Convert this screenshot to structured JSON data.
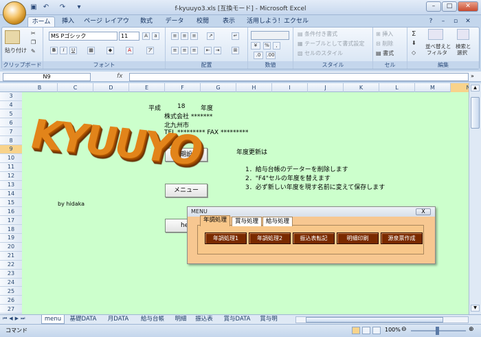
{
  "window": {
    "title": "f-kyuuyo3.xls  [互換モード] - Microsoft Excel"
  },
  "ribbon_tabs": [
    "ホーム",
    "挿入",
    "ページ レイアウト",
    "数式",
    "データ",
    "校閲",
    "表示",
    "活用しよう！エクセル"
  ],
  "ribbon": {
    "clipboard": {
      "paste": "貼り付け",
      "label": "クリップボード"
    },
    "font": {
      "name": "MS Pゴシック",
      "size": "11",
      "label": "フォント",
      "b": "B",
      "i": "I",
      "u": "U"
    },
    "alignment": {
      "label": "配置"
    },
    "number": {
      "label": "数値",
      "percent": "%",
      "comma": ","
    },
    "styles": {
      "cond": "条件付き書式",
      "table": "テーブルとして書式設定",
      "cell": "セルのスタイル",
      "label": "スタイル"
    },
    "cells": {
      "insert": "挿入",
      "delete": "削除",
      "format": "書式",
      "label": "セル"
    },
    "editing": {
      "sort": "並べ替えと",
      "sort2": "フィルタ",
      "find": "検索と",
      "find2": "選択",
      "sigma": "Σ",
      "label": "編集"
    }
  },
  "formula_bar": {
    "name_box": "N9",
    "fx": "fx",
    "value": ""
  },
  "columns": [
    "B",
    "C",
    "D",
    "E",
    "F",
    "G",
    "H",
    "I",
    "J",
    "K",
    "L",
    "M",
    "N"
  ],
  "rows": [
    "3",
    "4",
    "5",
    "6",
    "7",
    "8",
    "9",
    "10",
    "11",
    "12",
    "13",
    "14",
    "15",
    "16",
    "17",
    "18",
    "19",
    "20",
    "21",
    "22",
    "23",
    "24",
    "25",
    "26",
    "27"
  ],
  "selected_col": "N",
  "selected_row": "9",
  "sheet": {
    "year_label": "平成",
    "year_value": "18",
    "year_suffix": "年度",
    "company": "株式会社 *******",
    "city": "北九州市",
    "tel": "TEL *********  FAX *********",
    "logo": "KYUUYO",
    "author": "by hidaka",
    "btn_init": "初期設定",
    "btn_menu": "メニュー",
    "btn_help": "he",
    "update_title": "年度更新は",
    "update_1": "1．給与台帳のデーターを削除します",
    "update_2": "2．\"F4\"セルの年度を替えます",
    "update_3": "3．必ず新しい年度を現す名前に変えて保存します"
  },
  "menu_dialog": {
    "title": "MENU",
    "close": "X",
    "tabs": [
      "年調処理",
      "賞与処理",
      "給与処理"
    ],
    "buttons": [
      "年調処理1",
      "年調処理2",
      "振込表転記",
      "明細印刷",
      "源泉票作成"
    ]
  },
  "sheet_tabs": [
    "menu",
    "基礎DATA",
    "月DATA",
    "給与台帳",
    "明細",
    "振込表",
    "賞与DATA",
    "賞与明"
  ],
  "status": {
    "mode": "コマンド",
    "zoom": "100%"
  }
}
